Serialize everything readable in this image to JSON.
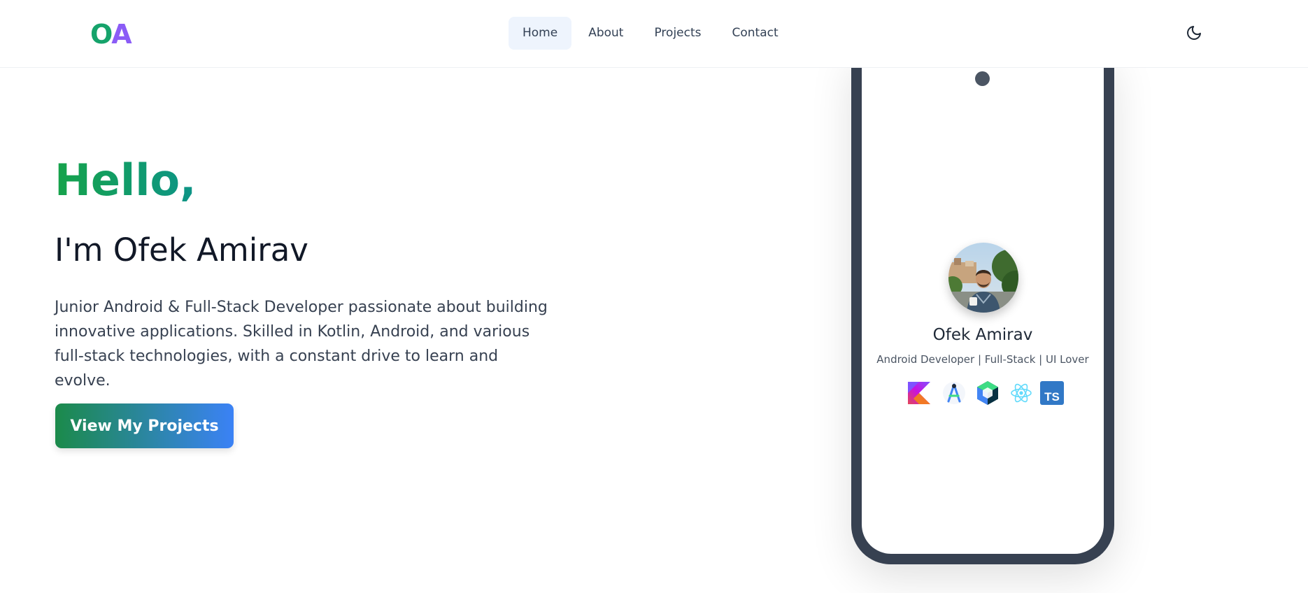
{
  "header": {
    "logo": {
      "first": "O",
      "second": "A"
    },
    "nav": [
      {
        "label": "Home",
        "active": true
      },
      {
        "label": "About",
        "active": false
      },
      {
        "label": "Projects",
        "active": false
      },
      {
        "label": "Contact",
        "active": false
      }
    ],
    "theme_toggle_icon": "moon-icon"
  },
  "hero": {
    "greeting": "Hello,",
    "heading": "I'm Ofek Amirav",
    "intro": "Junior Android & Full-Stack Developer passionate about building innovative applications. Skilled in Kotlin, Android, and various full-stack technologies, with a constant drive to learn and evolve.",
    "cta_label": "View My Projects"
  },
  "phone": {
    "profile_name": "Ofek Amirav",
    "tagline": "Android Developer | Full-Stack | UI Lover",
    "tech_icons": [
      "kotlin-icon",
      "android-studio-icon",
      "jetpack-compose-icon",
      "react-icon",
      "typescript-icon"
    ],
    "ts_badge_text": "TS"
  },
  "colors": {
    "accent_green": "#16a34a",
    "accent_blue": "#3b82f6",
    "logo_purple": "#8b5cf6",
    "phone_frame": "#374151"
  }
}
